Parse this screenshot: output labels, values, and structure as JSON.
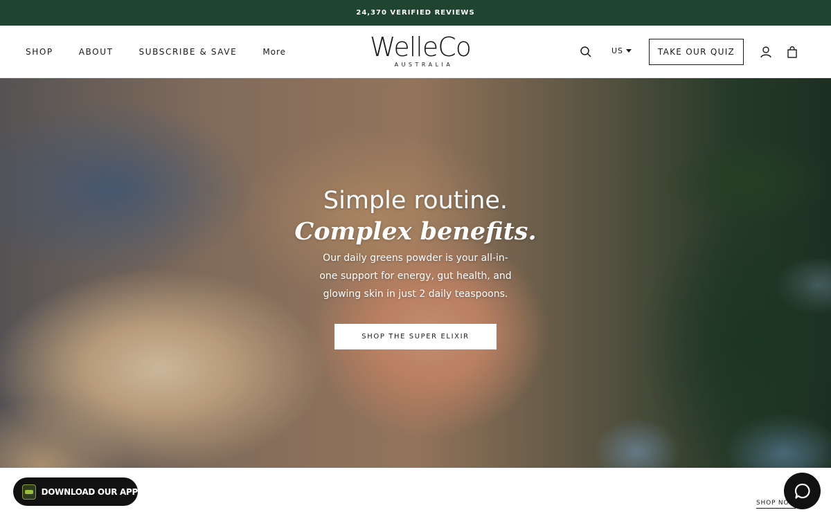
{
  "announcement": {
    "text": "24,370 VERIFIED REVIEWS"
  },
  "header": {
    "nav": [
      {
        "label": "SHOP"
      },
      {
        "label": "ABOUT"
      },
      {
        "label": "SUBSCRIBE & SAVE"
      },
      {
        "label": "More"
      }
    ],
    "logo": {
      "main": "WelleCo",
      "sub": "AUSTRALIA"
    },
    "search_icon": "search-icon",
    "country": "US",
    "quiz_label": "TAKE OUR QUIZ",
    "account_icon": "user-icon",
    "cart_icon": "shopping-bag-icon"
  },
  "hero": {
    "headline": "Simple routine.",
    "headline_italic": "Complex benefits.",
    "body": "Our daily greens powder is your all-in-one support for energy, gut health, and glowing skin in just 2 daily teaspoons.",
    "cta_label": "SHOP THE SUPER ELIXIR"
  },
  "footer_widgets": {
    "app_button_label": "DOWNLOAD OUR APP",
    "shop_now_label": "SHOP NOW",
    "chat_icon": "chat-bubble-icon"
  },
  "colors": {
    "announcement_bg": "#1f4530",
    "text": "#1a1a1a",
    "dark_widget": "#111111"
  }
}
